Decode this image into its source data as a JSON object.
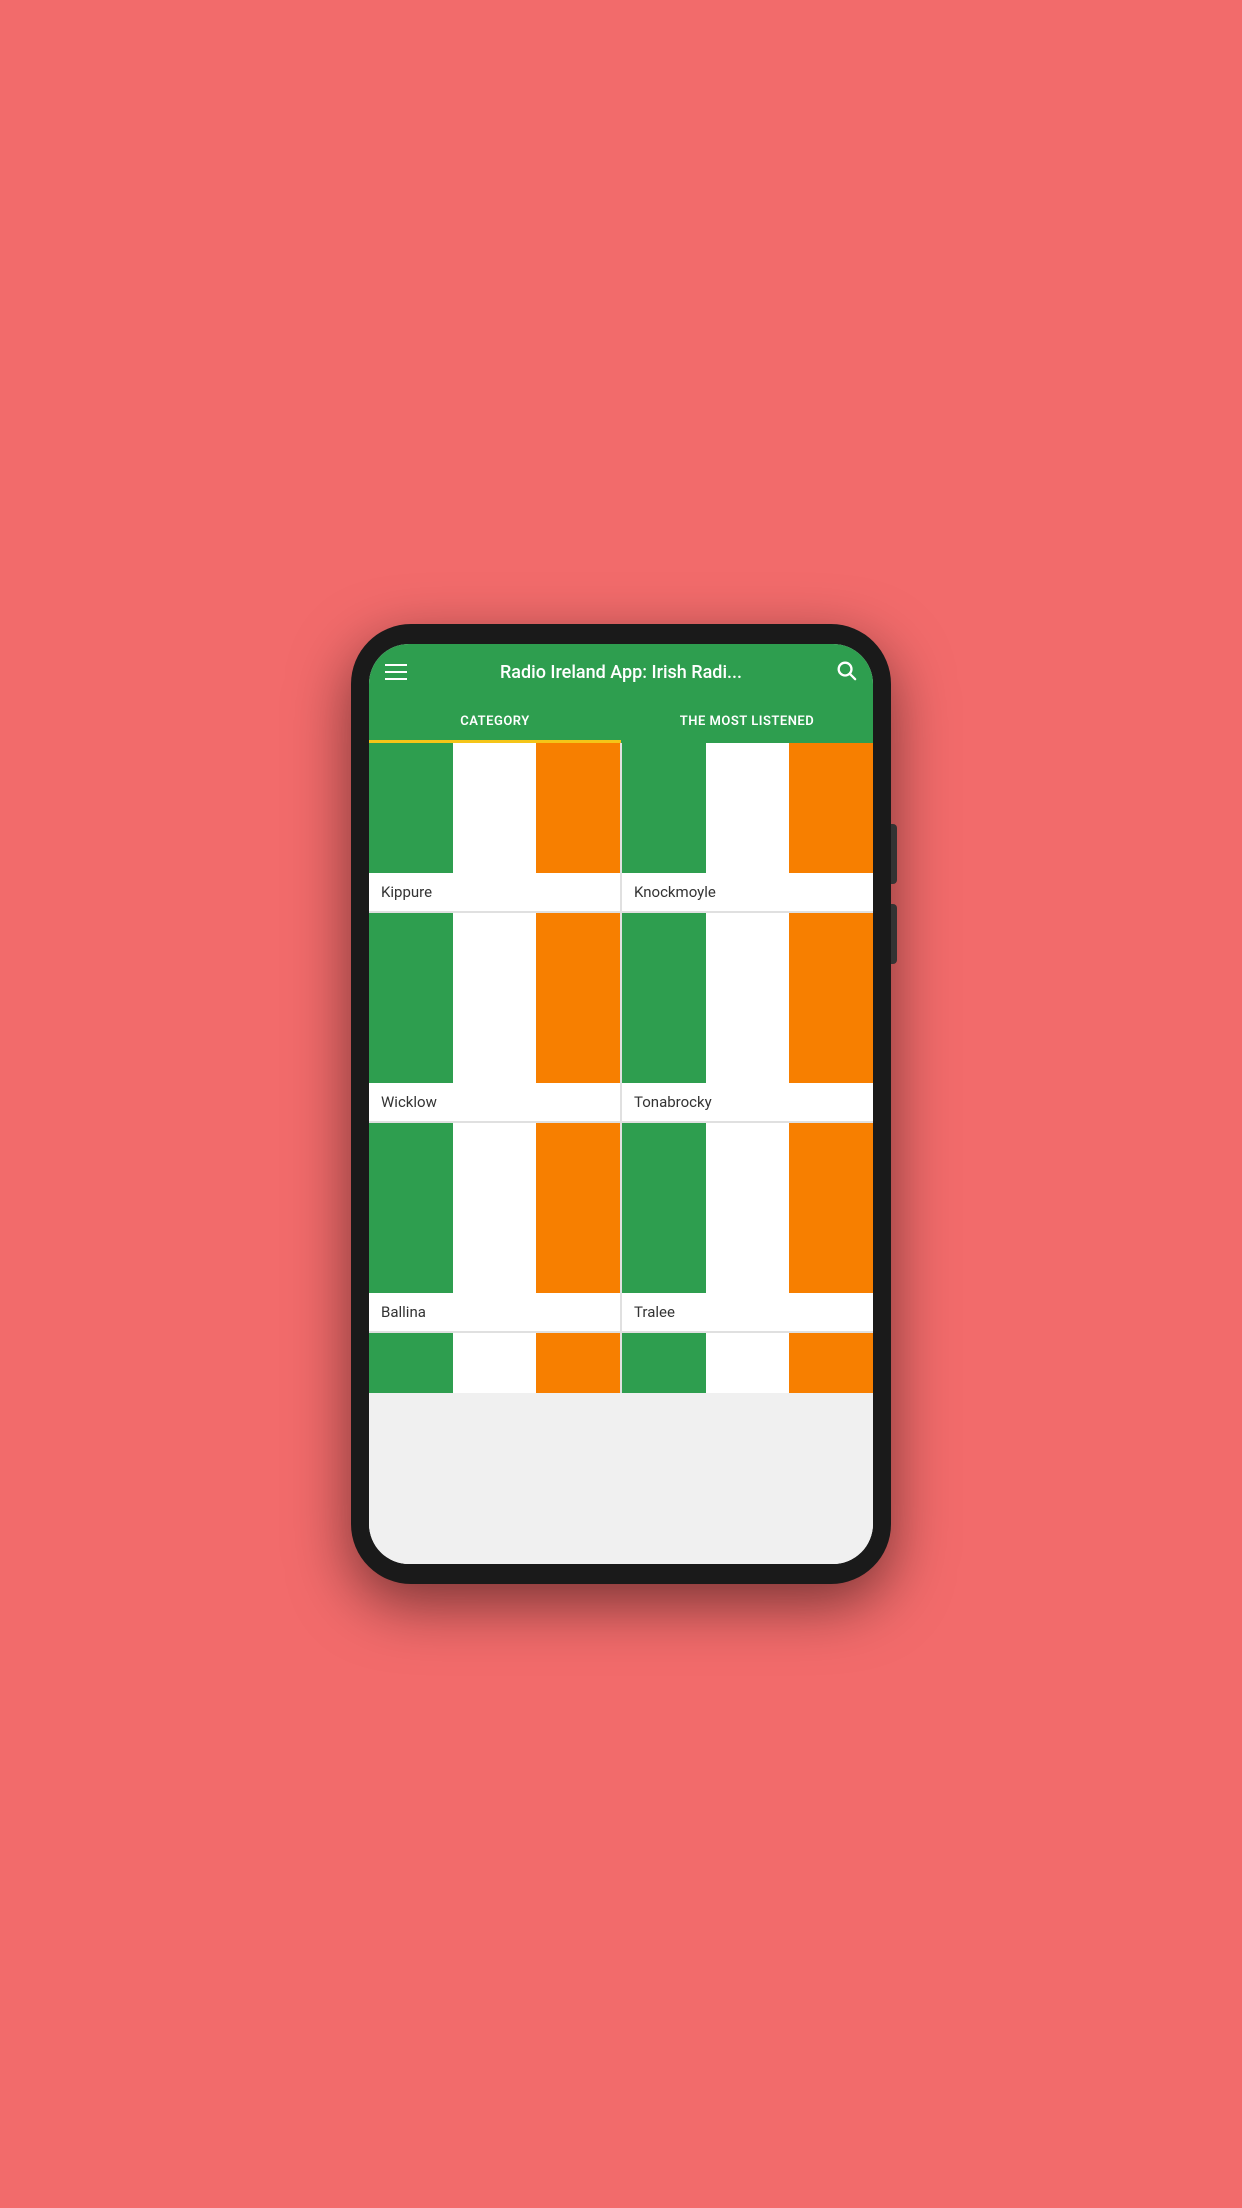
{
  "appBar": {
    "title": "Radio Ireland App: Irish Radi...",
    "menuLabel": "menu",
    "searchLabel": "search"
  },
  "tabs": [
    {
      "id": "category",
      "label": "CATEGORY",
      "active": true
    },
    {
      "id": "most-listened",
      "label": "THE MOST LISTENED",
      "active": false
    }
  ],
  "stations": [
    {
      "id": 1,
      "name": "Kippure"
    },
    {
      "id": 2,
      "name": "Knockmoyle"
    },
    {
      "id": 3,
      "name": "Wicklow"
    },
    {
      "id": 4,
      "name": "Tonabrocky"
    },
    {
      "id": 5,
      "name": "Ballina"
    },
    {
      "id": 6,
      "name": "Tralee"
    },
    {
      "id": 7,
      "name": ""
    },
    {
      "id": 8,
      "name": ""
    }
  ],
  "colors": {
    "appBarBg": "#2e9e4f",
    "activeTabIndicator": "#f5c518",
    "flagGreen": "#2e9e4f",
    "flagWhite": "#ffffff",
    "flagOrange": "#f77f00",
    "phoneBg": "#f26b6b"
  }
}
